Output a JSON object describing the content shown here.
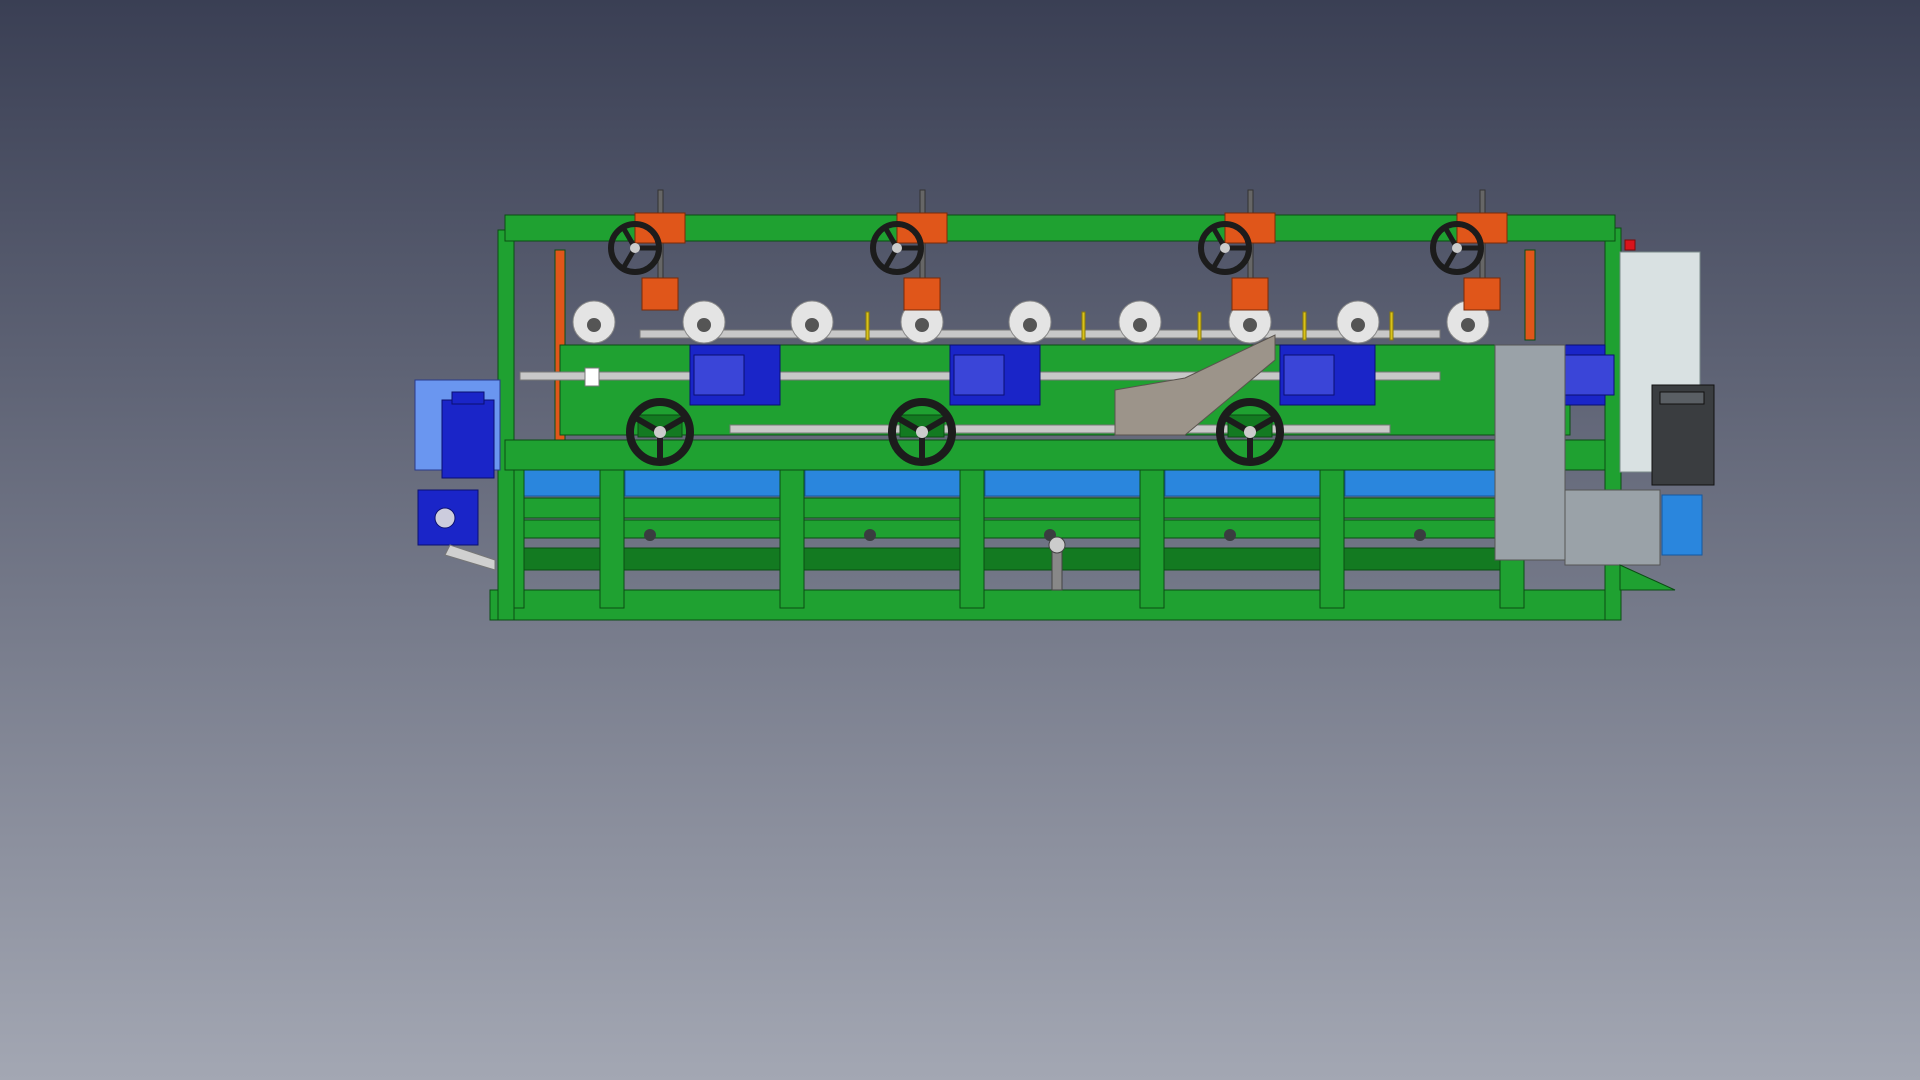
{
  "scene": {
    "background_top": "#3a3f54",
    "background_bottom": "#a3a7b3"
  },
  "palette": {
    "frame_green": "#1fa131",
    "frame_green_dark": "#137a21",
    "frame_outline": "#0b4d14",
    "belt_blue": "#2a86dd",
    "motor_blue": "#1a25c8",
    "motor_blue_light": "#6a96f0",
    "adjuster_orange": "#e0561a",
    "handwheel_black": "#1c1c1c",
    "roller_white": "#e4e4e4",
    "shaft_gray": "#c8c8c8",
    "guard_gray": "#9aa2a8",
    "cabinet_white": "#d9e1e2",
    "chute_gray": "#9c948a",
    "pump_dark": "#3a3d40",
    "warning_red": "#d8141b",
    "accent_yellow": "#d9c21a"
  },
  "machine": {
    "name_icon": "roll-forming-machine-icon",
    "top_adjuster_count": 4,
    "front_handwheel_count": 3,
    "roller_count": 9,
    "leg_count": 7,
    "components": [
      "top-frame-beam",
      "top-adjuster-handwheel",
      "front-handwheel",
      "forming-roller",
      "drive-motor",
      "gearbox",
      "conveyor-belt",
      "control-cabinet",
      "pump-unit",
      "side-guard",
      "discharge-chute",
      "base-frame"
    ]
  }
}
